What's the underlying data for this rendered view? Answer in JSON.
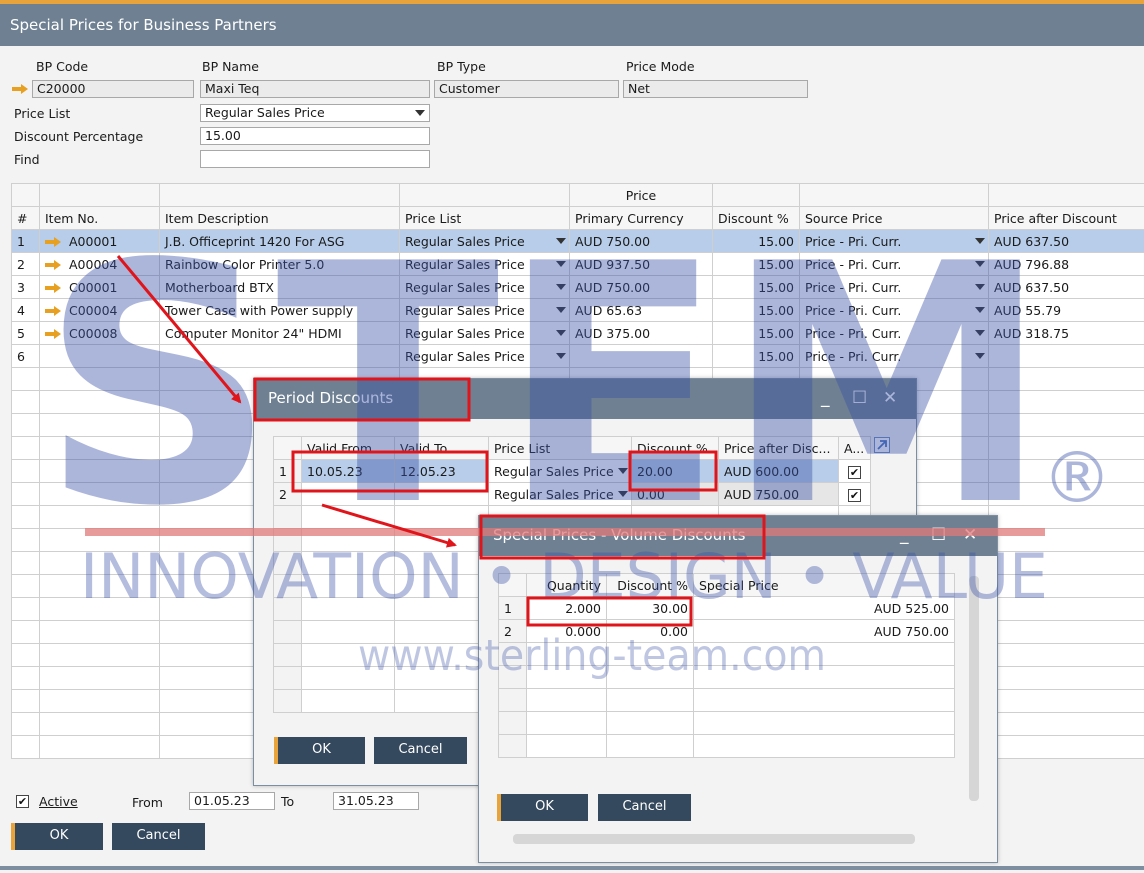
{
  "window": {
    "title": "Special Prices for Business Partners"
  },
  "header": {
    "bp_code_label": "BP Code",
    "bp_code": "C20000",
    "bp_name_label": "BP Name",
    "bp_name": "Maxi Teq",
    "bp_type_label": "BP Type",
    "bp_type": "Customer",
    "price_mode_label": "Price Mode",
    "price_mode": "Net",
    "price_list_label": "Price List",
    "price_list": "Regular Sales Price",
    "discount_label": "Discount Percentage",
    "discount": "15.00",
    "find_label": "Find",
    "find": ""
  },
  "main_grid": {
    "group_header": "Price",
    "columns": [
      "#",
      "Item No.",
      "Item Description",
      "Price List",
      "Primary Currency",
      "Discount %",
      "Source Price",
      "Price after Discount"
    ],
    "rows": [
      {
        "n": "1",
        "item": "A00001",
        "desc": "J.B. Officeprint 1420 For ASG",
        "pl": "Regular Sales Price",
        "cur": "AUD 750.00",
        "disc": "15.00",
        "src": "Price - Pri. Curr.",
        "after": "AUD 637.50"
      },
      {
        "n": "2",
        "item": "A00004",
        "desc": "Rainbow Color Printer 5.0",
        "pl": "Regular Sales Price",
        "cur": "AUD 937.50",
        "disc": "15.00",
        "src": "Price - Pri. Curr.",
        "after": "AUD 796.88"
      },
      {
        "n": "3",
        "item": "C00001",
        "desc": "Motherboard BTX",
        "pl": "Regular Sales Price",
        "cur": "AUD 750.00",
        "disc": "15.00",
        "src": "Price - Pri. Curr.",
        "after": "AUD 637.50"
      },
      {
        "n": "4",
        "item": "C00004",
        "desc": "Tower Case with Power supply",
        "pl": "Regular Sales Price",
        "cur": "AUD 65.63",
        "disc": "15.00",
        "src": "Price - Pri. Curr.",
        "after": "AUD 55.79"
      },
      {
        "n": "5",
        "item": "C00008",
        "desc": "Computer Monitor 24\" HDMI",
        "pl": "Regular Sales Price",
        "cur": "AUD 375.00",
        "disc": "15.00",
        "src": "Price - Pri. Curr.",
        "after": "AUD 318.75"
      },
      {
        "n": "6",
        "item": "",
        "desc": "",
        "pl": "Regular Sales Price",
        "cur": "",
        "disc": "15.00",
        "src": "Price - Pri. Curr.",
        "after": ""
      }
    ]
  },
  "footer": {
    "active_label": "Active",
    "from_label": "From",
    "from": "01.05.23",
    "to_label": "To",
    "to": "31.05.23",
    "ok": "OK",
    "cancel": "Cancel"
  },
  "period_window": {
    "title": "Period Discounts",
    "columns": [
      "Valid From",
      "Valid To",
      "Price List",
      "Discount %",
      "Price after Disc...",
      "A..."
    ],
    "rows": [
      {
        "n": "1",
        "from": "10.05.23",
        "to": "12.05.23",
        "pl": "Regular Sales Price",
        "disc": "20.00",
        "after": "AUD 600.00"
      },
      {
        "n": "2",
        "from": "",
        "to": "",
        "pl": "Regular Sales Price",
        "disc": "0.00",
        "after": "AUD 750.00"
      }
    ],
    "ok": "OK",
    "cancel": "Cancel"
  },
  "volume_window": {
    "title": "Special Prices - Volume Discounts",
    "columns": [
      "Quantity",
      "Discount %",
      "Special Price"
    ],
    "rows": [
      {
        "n": "1",
        "qty": "2.000",
        "disc": "30.00",
        "price": "AUD 525.00"
      },
      {
        "n": "2",
        "qty": "0.000",
        "disc": "0.00",
        "price": "AUD 750.00"
      }
    ],
    "ok": "OK",
    "cancel": "Cancel"
  },
  "watermark": {
    "brand": "STEM",
    "tagline": "INNOVATION • DESIGN • VALUE",
    "registered": "®",
    "url": "www.sterling-team.com"
  },
  "colors": {
    "titlebar": "#6e8092",
    "button": "#35495e",
    "accent": "#e8a33a",
    "selection": "#b7cdea",
    "highlight": "#e0151b",
    "watermark": "#3a52a8"
  }
}
